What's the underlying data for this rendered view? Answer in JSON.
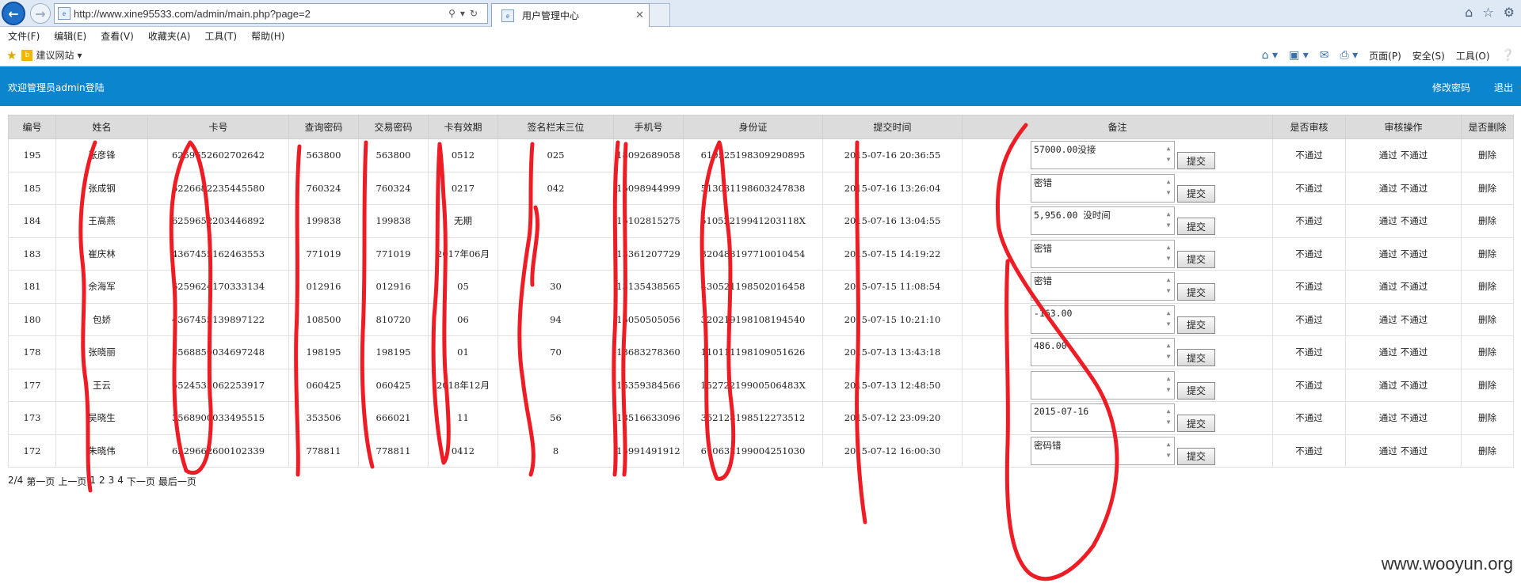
{
  "browser": {
    "url": "http://www.xine95533.com/admin/main.php?page=2",
    "tab_title": "用户管理中心",
    "menu": [
      "文件(F)",
      "编辑(E)",
      "查看(V)",
      "收藏夹(A)",
      "工具(T)",
      "帮助(H)"
    ],
    "favorites_site": "建议网站",
    "command_bar": [
      "页面(P)",
      "安全(S)",
      "工具(O)"
    ]
  },
  "header": {
    "welcome": "欢迎管理员admin登陆",
    "change_password": "修改密码",
    "logout": "退出"
  },
  "table": {
    "columns": [
      "编号",
      "姓名",
      "卡号",
      "查询密码",
      "交易密码",
      "卡有效期",
      "签名栏末三位",
      "手机号",
      "身份证",
      "提交时间",
      "备注",
      "是否审核",
      "审核操作",
      "是否删除"
    ],
    "submit_label": "提交",
    "status_label": "不通过",
    "action_pass": "通过",
    "action_reject": "不通过",
    "delete_label": "删除",
    "rows": [
      {
        "id": "195",
        "name": "张彦锋",
        "card": "6259652602702642",
        "query_pwd": "563800",
        "trade_pwd": "563800",
        "expiry": "0512",
        "cvv": "025",
        "phone": "18092689058",
        "idcard": "610525198309290895",
        "time": "2015-07-16 20:36:55",
        "note": "57000.00没接"
      },
      {
        "id": "185",
        "name": "张成钢",
        "card": "6226682235445580",
        "query_pwd": "760324",
        "trade_pwd": "760324",
        "expiry": "0217",
        "cvv": "042",
        "phone": "15098944999",
        "idcard": "513031198603247838",
        "time": "2015-07-16 13:26:04",
        "note": "密错"
      },
      {
        "id": "184",
        "name": "王高燕",
        "card": "6259652203446892",
        "query_pwd": "199838",
        "trade_pwd": "199838",
        "expiry": "无期",
        "cvv": "",
        "phone": "15102815275",
        "idcard": "51052219941203118X",
        "time": "2015-07-16 13:04:55",
        "note": "5,956.00 没时间"
      },
      {
        "id": "183",
        "name": "崔庆林",
        "card": "4367455162463553",
        "query_pwd": "771019",
        "trade_pwd": "771019",
        "expiry": "2017年06月",
        "cvv": "",
        "phone": "13361207729",
        "idcard": "320483197710010454",
        "time": "2015-07-15 14:19:22",
        "note": "密错"
      },
      {
        "id": "181",
        "name": "余海军",
        "card": "6259624170333134",
        "query_pwd": "012916",
        "trade_pwd": "012916",
        "expiry": "05",
        "cvv": "30",
        "phone": "13135438565",
        "idcard": "430521198502016458",
        "time": "2015-07-15 11:08:54",
        "note": "密错"
      },
      {
        "id": "180",
        "name": "包娇",
        "card": "4367455139897122",
        "query_pwd": "108500",
        "trade_pwd": "810720",
        "expiry": "06",
        "cvv": "94",
        "phone": "15050505056",
        "idcard": "320219198108194540",
        "time": "2015-07-15 10:21:10",
        "note": " -163.00"
      },
      {
        "id": "178",
        "name": "张晓丽",
        "card": "3568850034697248",
        "query_pwd": "198195",
        "trade_pwd": "198195",
        "expiry": "01",
        "cvv": "70",
        "phone": "13683278360",
        "idcard": "110111198109051626",
        "time": "2015-07-13 13:43:18",
        "note": "486.00"
      },
      {
        "id": "177",
        "name": "王云",
        "card": "5524535062253917",
        "query_pwd": "060425",
        "trade_pwd": "060425",
        "expiry": "2018年12月",
        "cvv": "",
        "phone": "15359384566",
        "idcard": "15272219900506483X",
        "time": "2015-07-13 12:48:50",
        "note": ""
      },
      {
        "id": "173",
        "name": "吴晓生",
        "card": "3568900033495515",
        "query_pwd": "353506",
        "trade_pwd": "666021",
        "expiry": "11",
        "cvv": "56",
        "phone": "13516633096",
        "idcard": "352128198512273512",
        "time": "2015-07-12 23:09:20",
        "note": "2015-07-16"
      },
      {
        "id": "172",
        "name": "朱晓伟",
        "card": "6229662600102339",
        "query_pwd": "778811",
        "trade_pwd": "778811",
        "expiry": "0412",
        "cvv": "8",
        "phone": "15991491912",
        "idcard": "610632199004251030",
        "time": "2015-07-12 16:00:30",
        "note": "密码错"
      }
    ]
  },
  "pager": {
    "status": "2/4",
    "first": "第一页",
    "prev": "上一页",
    "pages": [
      "1",
      "2",
      "3",
      "4"
    ],
    "next": "下一页",
    "last": "最后一页"
  },
  "watermark": "www.wooyun.org"
}
